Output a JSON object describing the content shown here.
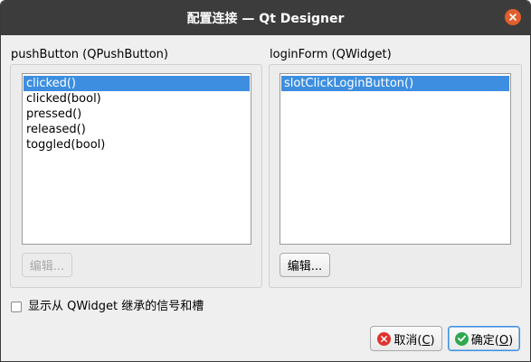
{
  "window": {
    "title": "配置连接 — Qt Designer"
  },
  "sender": {
    "label": "pushButton (QPushButton)",
    "signals": [
      "clicked()",
      "clicked(bool)",
      "pressed()",
      "released()",
      "toggled(bool)"
    ],
    "selected_index": 0,
    "edit_label": "编辑..."
  },
  "receiver": {
    "label": "loginForm (QWidget)",
    "slots": [
      "slotClickLoginButton()"
    ],
    "selected_index": 0,
    "edit_label": "编辑..."
  },
  "options": {
    "show_inherited_label": "显示从 QWidget 继承的信号和槽",
    "show_inherited_checked": false
  },
  "buttons": {
    "cancel_text": "取消(",
    "cancel_mnemonic": "C",
    "cancel_end": ")",
    "ok_text": "确定(",
    "ok_mnemonic": "O",
    "ok_end": ")"
  },
  "colors": {
    "selection": "#3d8ee0",
    "titlebar": "#3c3c3c",
    "close": "#e05f2c",
    "cancel_icon": "#e0322e",
    "ok_icon": "#2fa84f"
  }
}
